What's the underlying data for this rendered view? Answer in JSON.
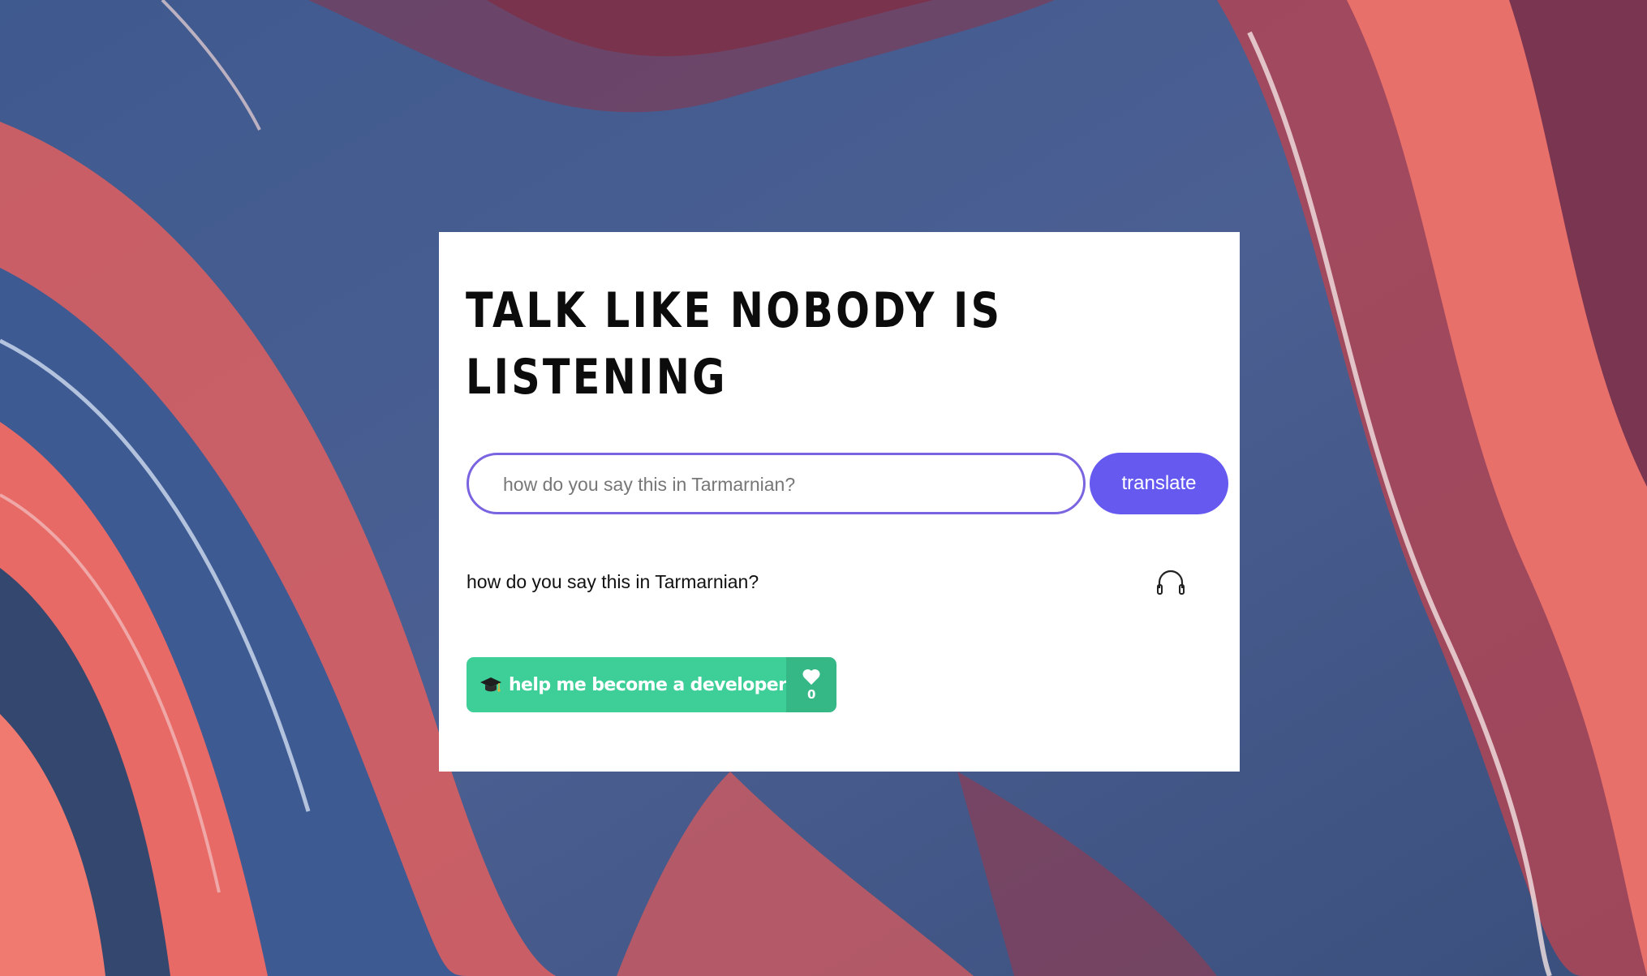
{
  "page": {
    "title_line": "Talk like nobody is listening"
  },
  "translator": {
    "input_placeholder": "how do you say this in Tarmarnian?",
    "input_value": "",
    "translate_label": "translate",
    "output_text": "how do you say this in Tarmarnian?",
    "listen_icon": "headphones-icon"
  },
  "support": {
    "emoji_icon": "graduation-cap-icon",
    "label": "help me become a developer",
    "like_icon": "heart-icon",
    "count": "0"
  },
  "colors": {
    "accent": "#6659f0",
    "input_border": "#7a64e0",
    "support_green": "#3ecf98",
    "support_green_dark": "#36b886"
  }
}
